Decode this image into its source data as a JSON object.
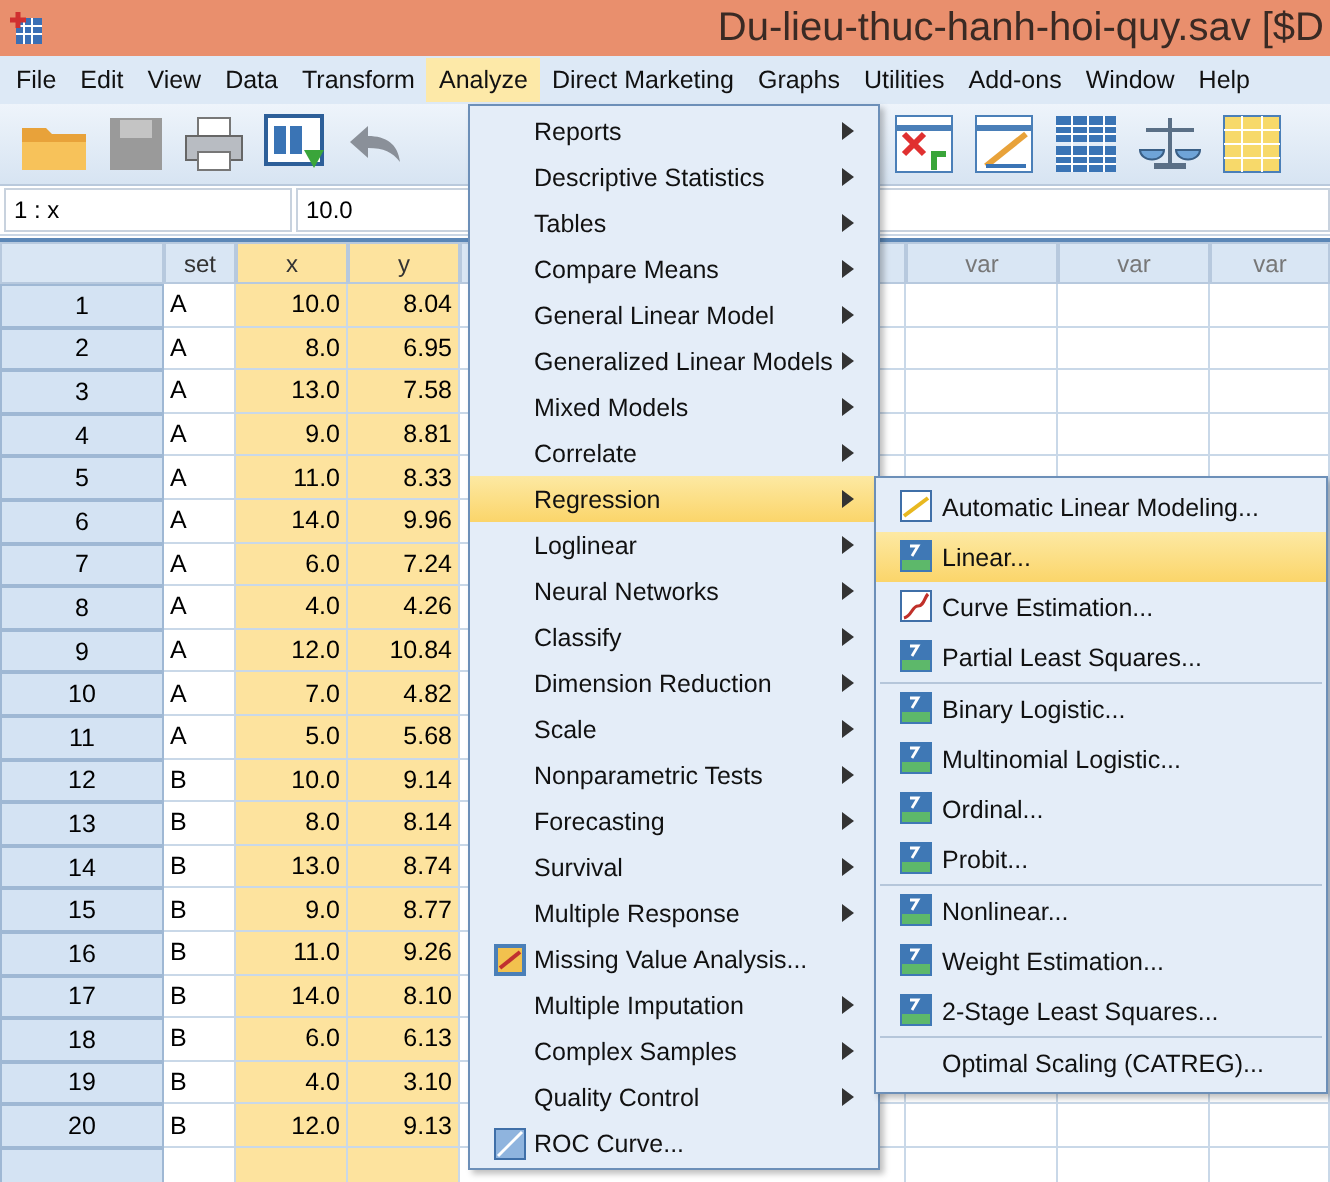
{
  "window": {
    "title": "Du-lieu-thuc-hanh-hoi-quy.sav [$D"
  },
  "menu_bar": [
    {
      "label": "File",
      "selected": false
    },
    {
      "label": "Edit",
      "selected": false
    },
    {
      "label": "View",
      "selected": false
    },
    {
      "label": "Data",
      "selected": false
    },
    {
      "label": "Transform",
      "selected": false
    },
    {
      "label": "Analyze",
      "selected": true
    },
    {
      "label": "Direct Marketing",
      "selected": false
    },
    {
      "label": "Graphs",
      "selected": false
    },
    {
      "label": "Utilities",
      "selected": false
    },
    {
      "label": "Add-ons",
      "selected": false
    },
    {
      "label": "Window",
      "selected": false
    },
    {
      "label": "Help",
      "selected": false
    }
  ],
  "cell_bar": {
    "reference": "1 : x",
    "value": "10.0"
  },
  "table": {
    "columns": [
      "set",
      "x",
      "y",
      "",
      "var",
      "var",
      "var"
    ],
    "rows": [
      [
        "1",
        "A",
        "10.0",
        "8.04"
      ],
      [
        "2",
        "A",
        "8.0",
        "6.95"
      ],
      [
        "3",
        "A",
        "13.0",
        "7.58"
      ],
      [
        "4",
        "A",
        "9.0",
        "8.81"
      ],
      [
        "5",
        "A",
        "11.0",
        "8.33"
      ],
      [
        "6",
        "A",
        "14.0",
        "9.96"
      ],
      [
        "7",
        "A",
        "6.0",
        "7.24"
      ],
      [
        "8",
        "A",
        "4.0",
        "4.26"
      ],
      [
        "9",
        "A",
        "12.0",
        "10.84"
      ],
      [
        "10",
        "A",
        "7.0",
        "4.82"
      ],
      [
        "11",
        "A",
        "5.0",
        "5.68"
      ],
      [
        "12",
        "B",
        "10.0",
        "9.14"
      ],
      [
        "13",
        "B",
        "8.0",
        "8.14"
      ],
      [
        "14",
        "B",
        "13.0",
        "8.74"
      ],
      [
        "15",
        "B",
        "9.0",
        "8.77"
      ],
      [
        "16",
        "B",
        "11.0",
        "9.26"
      ],
      [
        "17",
        "B",
        "14.0",
        "8.10"
      ],
      [
        "18",
        "B",
        "6.0",
        "6.13"
      ],
      [
        "19",
        "B",
        "4.0",
        "3.10"
      ],
      [
        "20",
        "B",
        "12.0",
        "9.13"
      ]
    ]
  },
  "analyze_menu": [
    {
      "label": "Reports",
      "kind": "submenu",
      "selected": false
    },
    {
      "label": "Descriptive Statistics",
      "kind": "submenu",
      "selected": false
    },
    {
      "label": "Tables",
      "kind": "submenu",
      "selected": false
    },
    {
      "label": "Compare Means",
      "kind": "submenu",
      "selected": false
    },
    {
      "label": "General Linear Model",
      "kind": "submenu",
      "selected": false
    },
    {
      "label": "Generalized Linear Models",
      "kind": "submenu",
      "selected": false
    },
    {
      "label": "Mixed Models",
      "kind": "submenu",
      "selected": false
    },
    {
      "label": "Correlate",
      "kind": "submenu",
      "selected": false
    },
    {
      "label": "Regression",
      "kind": "submenu",
      "selected": true
    },
    {
      "label": "Loglinear",
      "kind": "submenu",
      "selected": false
    },
    {
      "label": "Neural Networks",
      "kind": "submenu",
      "selected": false
    },
    {
      "label": "Classify",
      "kind": "submenu",
      "selected": false
    },
    {
      "label": "Dimension Reduction",
      "kind": "submenu",
      "selected": false
    },
    {
      "label": "Scale",
      "kind": "submenu",
      "selected": false
    },
    {
      "label": "Nonparametric Tests",
      "kind": "submenu",
      "selected": false
    },
    {
      "label": "Forecasting",
      "kind": "submenu",
      "selected": false
    },
    {
      "label": "Survival",
      "kind": "submenu",
      "selected": false
    },
    {
      "label": "Multiple Response",
      "kind": "submenu",
      "selected": false
    },
    {
      "label": "Missing Value Analysis...",
      "kind": "action",
      "selected": false
    },
    {
      "label": "Multiple Imputation",
      "kind": "submenu",
      "selected": false
    },
    {
      "label": "Complex Samples",
      "kind": "submenu",
      "selected": false
    },
    {
      "label": "Quality Control",
      "kind": "submenu",
      "selected": false
    },
    {
      "label": "ROC Curve...",
      "kind": "action",
      "selected": false
    }
  ],
  "regression_menu": [
    [
      {
        "label": "Automatic Linear Modeling...",
        "kind": "auto",
        "selected": false
      },
      {
        "label": "Linear...",
        "kind": "r",
        "selected": true
      },
      {
        "label": "Curve Estimation...",
        "kind": "curve",
        "selected": false
      },
      {
        "label": "Partial Least Squares...",
        "kind": "r",
        "selected": false
      }
    ],
    [
      {
        "label": "Binary Logistic...",
        "kind": "r",
        "selected": false
      },
      {
        "label": "Multinomial Logistic...",
        "kind": "r",
        "selected": false
      },
      {
        "label": "Ordinal...",
        "kind": "r",
        "selected": false
      },
      {
        "label": "Probit...",
        "kind": "r",
        "selected": false
      }
    ],
    [
      {
        "label": "Nonlinear...",
        "kind": "r",
        "selected": false
      },
      {
        "label": "Weight Estimation...",
        "kind": "r",
        "selected": false
      },
      {
        "label": "2-Stage Least Squares...",
        "kind": "r",
        "selected": false
      }
    ],
    [
      {
        "label": "Optimal Scaling (CATREG)...",
        "kind": "plain",
        "selected": false
      }
    ]
  ]
}
